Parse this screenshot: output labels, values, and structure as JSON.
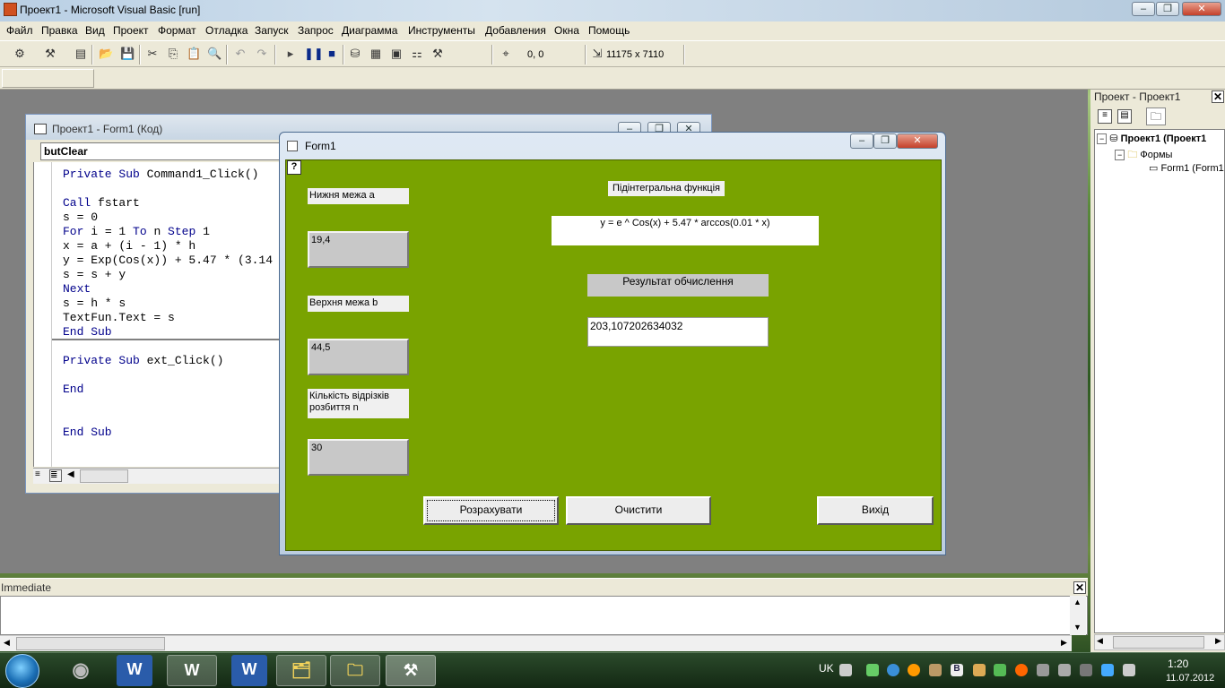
{
  "window": {
    "title": "Проект1 - Microsoft Visual Basic [run]"
  },
  "menu": [
    "Файл",
    "Правка",
    "Вид",
    "Проект",
    "Формат",
    "Отладка",
    "Запуск",
    "Запрос",
    "Диаграмма",
    "Инструменты",
    "Добавления",
    "Окна",
    "Помощь"
  ],
  "toolbar": {
    "position": "0, 0",
    "size": "11175 x 7110"
  },
  "code_window": {
    "title": "Проект1 - Form1 (Код)",
    "object_combo": "butClear",
    "lines": [
      "Private Sub Command1_Click()",
      "",
      "Call fstart",
      "s = 0",
      "For i = 1 To n Step 1",
      "x = a + (i - 1) * h",
      "y = Exp(Cos(x)) + 5.47 * (3.14",
      "s = s + y",
      "Next",
      "s = h * s",
      "TextFun.Text = s",
      "End Sub",
      "",
      "Private Sub ext_Click()",
      "",
      "End",
      "",
      "",
      "End Sub"
    ]
  },
  "project": {
    "title": "Проект - Проект1",
    "tree": [
      "Проект1 (Проект1",
      "Формы",
      "Form1 (Form1"
    ]
  },
  "immediate": {
    "title": "Immediate"
  },
  "form1": {
    "title": "Form1",
    "lower_label": "Нижня межа a",
    "lower_value": "19,4",
    "upper_label": "Верхня межа b",
    "upper_value": "44,5",
    "count_label": "Кількість відрізків розбиття n",
    "count_value": "30",
    "func_label": "Підінтегральна функція",
    "func_value": "y = e ^ Cos(x) + 5.47 * arccos(0.01 * x)",
    "result_label": "Результат обчислення",
    "result_value": "203,107202634032",
    "calc_button": "Розрахувати",
    "clear_button": "Очистити",
    "exit_button": "Вихід"
  },
  "taskbar": {
    "lang": "UK",
    "time": "1:20",
    "date": "11.07.2012"
  },
  "colors": {
    "form_bg": "#79a300"
  }
}
